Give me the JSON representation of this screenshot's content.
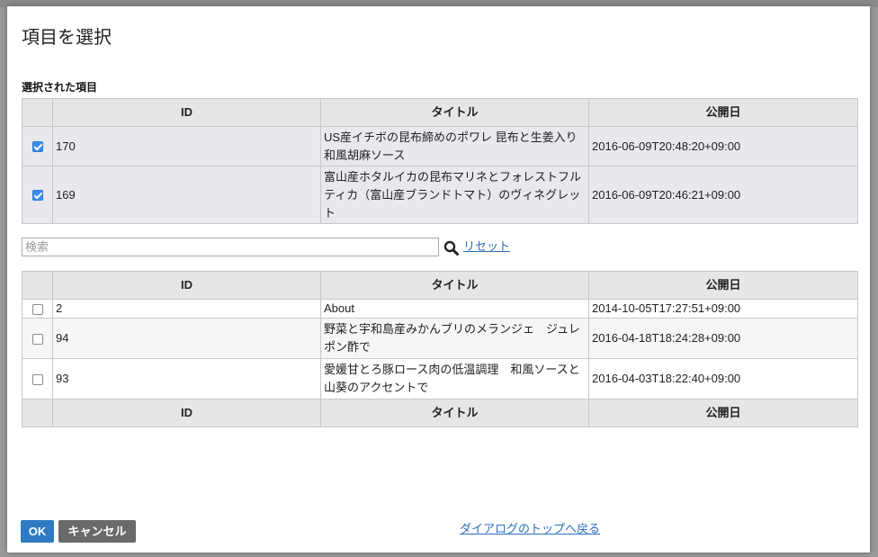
{
  "dialog": {
    "title": "項目を選択",
    "selected_section_label": "選択された項目"
  },
  "columns": {
    "id": "ID",
    "title": "タイトル",
    "date": "公開日"
  },
  "selected_items": [
    {
      "checked": true,
      "id": "170",
      "title": "US産イチボの昆布締めのポワレ 昆布と生姜入り和風胡麻ソース",
      "date": "2016-06-09T20:48:20+09:00"
    },
    {
      "checked": true,
      "id": "169",
      "title": "富山産ホタルイカの昆布マリネとフォレストフルティカ（富山産ブランドトマト）のヴィネグレット",
      "date": "2016-06-09T20:46:21+09:00"
    }
  ],
  "search": {
    "placeholder": "検索",
    "value": "",
    "reset_label": "リセット",
    "icon": "search-icon"
  },
  "results": [
    {
      "checked": false,
      "id": "2",
      "title": "About",
      "date": "2014-10-05T17:27:51+09:00"
    },
    {
      "checked": false,
      "id": "94",
      "title": "野菜と宇和島産みかんブリのメランジェ　ジュレポン酢で",
      "date": "2016-04-18T18:24:28+09:00"
    },
    {
      "checked": false,
      "id": "93",
      "title": "愛媛甘とろ豚ロース肉の低温調理　和風ソースと山葵のアクセントで",
      "date": "2016-04-03T18:22:40+09:00"
    }
  ],
  "footer": {
    "ok_label": "OK",
    "cancel_label": "キャンセル",
    "back_to_top_label": "ダイアログのトップへ戻る"
  },
  "colors": {
    "accent": "#2e7bc4",
    "checkbox_checked": "#3b8ded",
    "link": "#2a6ebb"
  }
}
